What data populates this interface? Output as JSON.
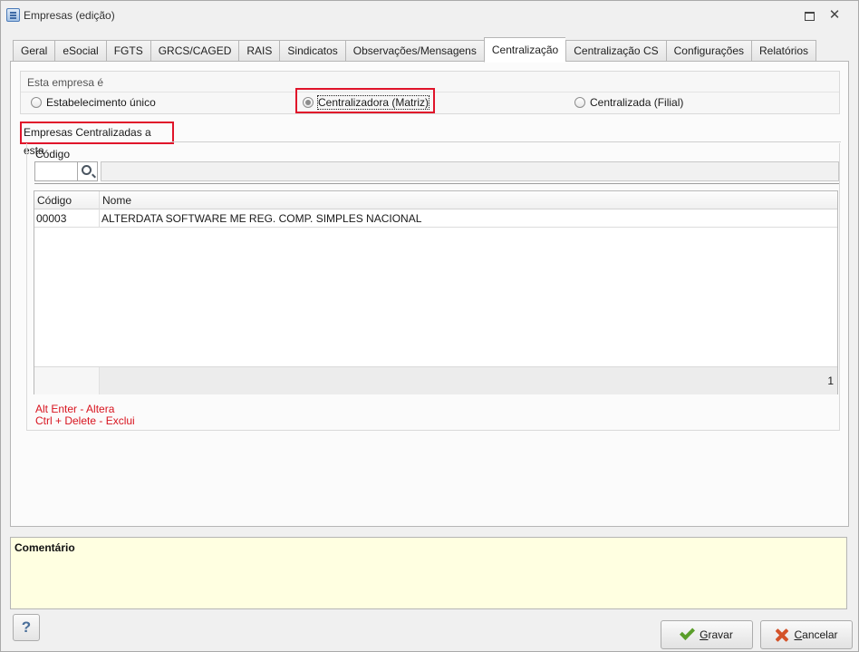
{
  "window": {
    "title": "Empresas (edição)"
  },
  "tabs": [
    {
      "label": "Geral"
    },
    {
      "label": "eSocial"
    },
    {
      "label": "FGTS"
    },
    {
      "label": "GRCS/CAGED"
    },
    {
      "label": "RAIS"
    },
    {
      "label": "Sindicatos"
    },
    {
      "label": "Observações/Mensagens"
    },
    {
      "label": "Centralização",
      "active": true
    },
    {
      "label": "Centralização CS"
    },
    {
      "label": "Configurações"
    },
    {
      "label": "Relatórios"
    }
  ],
  "esta_empresa": {
    "caption": "Esta empresa é",
    "options": [
      {
        "label": "Estabelecimento único",
        "checked": false
      },
      {
        "label": "Centralizadora (Matriz)",
        "checked": true
      },
      {
        "label": "Centralizada (Filial)",
        "checked": false
      }
    ]
  },
  "centralizadas": {
    "caption": "Empresas Centralizadas a esta",
    "codigo_label": "Código",
    "codigo_value": "",
    "nome_value": "",
    "grid": {
      "columns": [
        "Código",
        "Nome"
      ],
      "rows": [
        {
          "codigo": "00003",
          "nome": "ALTERDATA SOFTWARE ME REG. COMP.  SIMPLES NACIONAL"
        }
      ],
      "footer_count": "1"
    },
    "hints": [
      "Alt Enter - Altera",
      "Ctrl + Delete - Exclui"
    ]
  },
  "comment": {
    "label": "Comentário",
    "value": ""
  },
  "buttons": {
    "help": "?",
    "save": "Gravar",
    "cancel": "Cancelar"
  },
  "colors": {
    "highlight": "#e0142a",
    "hint_text": "#d8141f",
    "comment_bg": "#ffffe1"
  }
}
